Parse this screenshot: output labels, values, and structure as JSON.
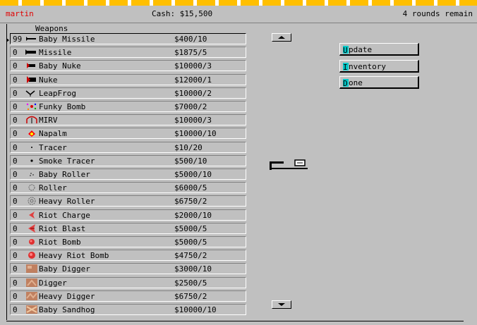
{
  "header": {
    "player": "martin",
    "cash": "Cash: $15,500",
    "rounds": "4 rounds remain"
  },
  "list_title": "Weapons",
  "weapons": [
    {
      "qty": "99",
      "name": "Baby Missile",
      "price": "$400/10",
      "icon": "baby-missile-icon"
    },
    {
      "qty": "0",
      "name": "Missile",
      "price": "$1875/5",
      "icon": "missile-icon"
    },
    {
      "qty": "0",
      "name": "Baby Nuke",
      "price": "$10000/3",
      "icon": "baby-nuke-icon"
    },
    {
      "qty": "0",
      "name": "Nuke",
      "price": "$12000/1",
      "icon": "nuke-icon"
    },
    {
      "qty": "0",
      "name": "LeapFrog",
      "price": "$10000/2",
      "icon": "leapfrog-icon"
    },
    {
      "qty": "0",
      "name": "Funky Bomb",
      "price": "$7000/2",
      "icon": "funky-bomb-icon"
    },
    {
      "qty": "0",
      "name": "MIRV",
      "price": "$10000/3",
      "icon": "mirv-icon"
    },
    {
      "qty": "0",
      "name": "Napalm",
      "price": "$10000/10",
      "icon": "napalm-icon"
    },
    {
      "qty": "0",
      "name": "Tracer",
      "price": "$10/20",
      "icon": "tracer-icon"
    },
    {
      "qty": "0",
      "name": "Smoke Tracer",
      "price": "$500/10",
      "icon": "smoke-tracer-icon"
    },
    {
      "qty": "0",
      "name": "Baby Roller",
      "price": "$5000/10",
      "icon": "baby-roller-icon"
    },
    {
      "qty": "0",
      "name": "Roller",
      "price": "$6000/5",
      "icon": "roller-icon"
    },
    {
      "qty": "0",
      "name": "Heavy Roller",
      "price": "$6750/2",
      "icon": "heavy-roller-icon"
    },
    {
      "qty": "0",
      "name": "Riot Charge",
      "price": "$2000/10",
      "icon": "riot-charge-icon"
    },
    {
      "qty": "0",
      "name": "Riot Blast",
      "price": "$5000/5",
      "icon": "riot-blast-icon"
    },
    {
      "qty": "0",
      "name": "Riot Bomb",
      "price": "$5000/5",
      "icon": "riot-bomb-icon"
    },
    {
      "qty": "0",
      "name": "Heavy Riot Bomb",
      "price": "$4750/2",
      "icon": "heavy-riot-bomb-icon"
    },
    {
      "qty": "0",
      "name": "Baby Digger",
      "price": "$3000/10",
      "icon": "baby-digger-icon"
    },
    {
      "qty": "0",
      "name": "Digger",
      "price": "$2500/5",
      "icon": "digger-icon"
    },
    {
      "qty": "0",
      "name": "Heavy Digger",
      "price": "$6750/2",
      "icon": "heavy-digger-icon"
    },
    {
      "qty": "0",
      "name": "Baby Sandhog",
      "price": "$10000/10",
      "icon": "baby-sandhog-icon"
    }
  ],
  "buttons": {
    "update": {
      "hotkey": "U",
      "label": "pdate"
    },
    "inventory": {
      "hotkey": "I",
      "label": "nventory"
    },
    "done": {
      "hotkey": "D",
      "label": "one"
    }
  },
  "colors": {
    "background": "#c0c0c0",
    "player_name": "#e00000",
    "hotkey_highlight": "#00c8c8",
    "top_stripe": "#ffbf00"
  }
}
